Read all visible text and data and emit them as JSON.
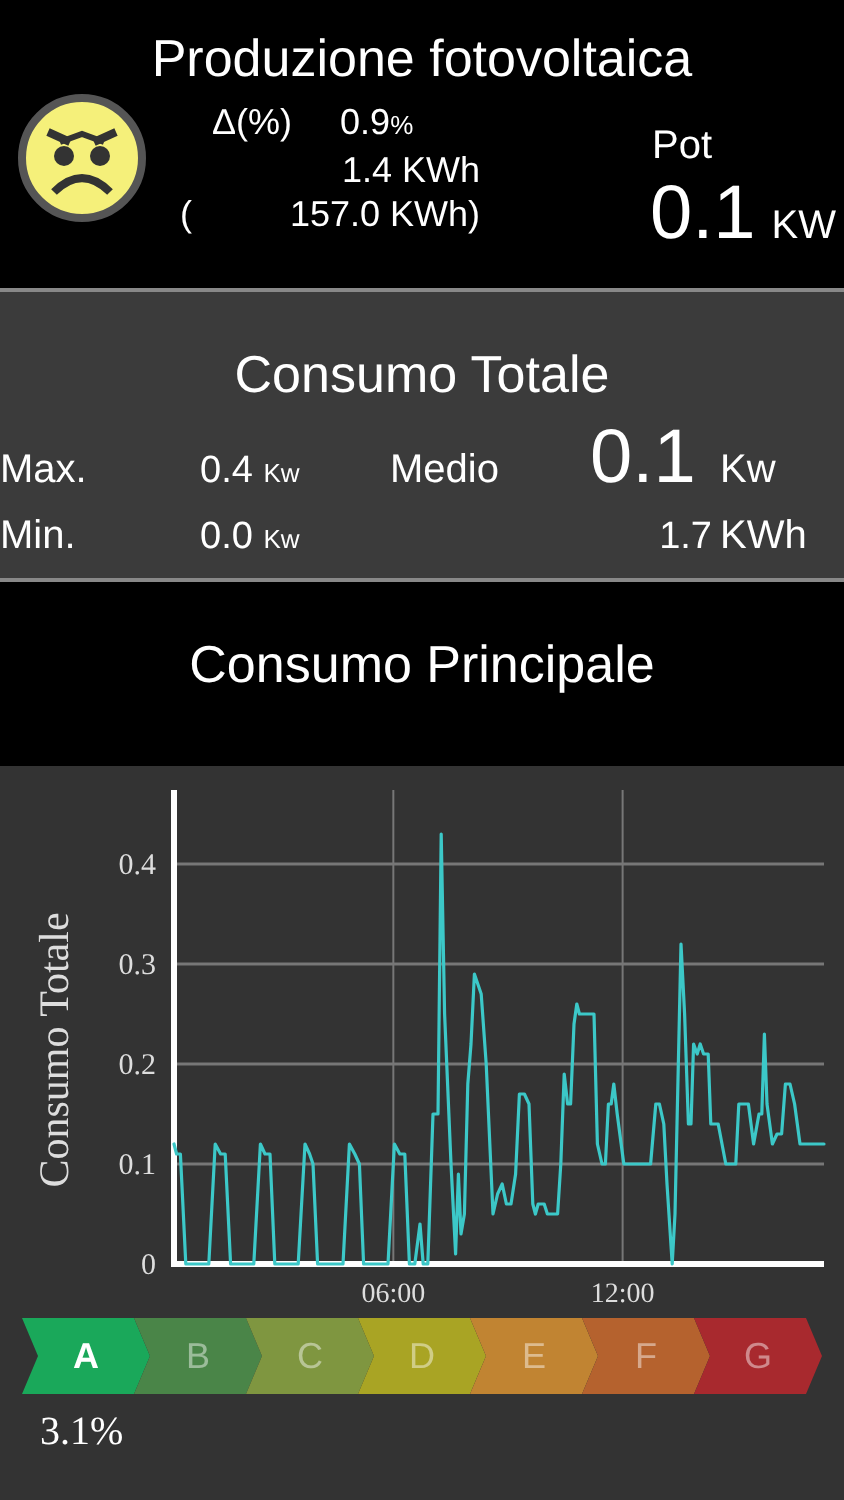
{
  "production": {
    "title": "Produzione fotovoltaica",
    "delta_label": "Δ(%)",
    "delta_value": "0.9",
    "delta_unit": "%",
    "energy": "1.4 KWh",
    "total_open": "(",
    "total": "157.0 KWh)",
    "power_label": "Pot",
    "power_value": "0.1",
    "power_unit": "KW"
  },
  "sections": [
    {
      "title": "Consumo Totale",
      "max_label": "Max.",
      "max_value": "0.4",
      "max_unit": "Kw",
      "avg_label": "Medio",
      "avg_value": "0.1",
      "avg_unit": "Kw",
      "min_label": "Min.",
      "min_value": "0.0",
      "min_unit": "Kw",
      "energy_value": "1.7",
      "energy_unit": "KWh"
    },
    {
      "title": "Consumo Principale"
    }
  ],
  "chart": {
    "chart_data": {
      "type": "line",
      "grid": true,
      "ylabel": "Consumo Totale",
      "xlim": [
        0.26,
        17.27
      ],
      "ylim": [
        0,
        0.47
      ],
      "yticks": [
        0,
        0.1,
        0.2,
        0.3,
        0.4
      ],
      "xticks": [
        {
          "value": 6,
          "label": "06:00"
        },
        {
          "value": 12,
          "label": "12:00"
        }
      ],
      "x": [
        0.26,
        0.33,
        0.43,
        0.57,
        1.17,
        1.34,
        1.48,
        1.6,
        1.74,
        2.35,
        2.52,
        2.64,
        2.77,
        2.9,
        3.51,
        3.69,
        3.81,
        3.9,
        4.02,
        4.68,
        4.85,
        4.99,
        5.11,
        5.22,
        5.86,
        6.03,
        6.17,
        6.3,
        6.42,
        6.56,
        6.7,
        6.78,
        6.9,
        7.04,
        7.17,
        7.25,
        7.34,
        7.51,
        7.63,
        7.7,
        7.77,
        7.86,
        7.95,
        8.03,
        8.12,
        8.21,
        8.3,
        8.43,
        8.61,
        8.73,
        8.85,
        8.96,
        9.08,
        9.2,
        9.3,
        9.43,
        9.55,
        9.65,
        9.72,
        9.79,
        9.95,
        10.03,
        10.3,
        10.38,
        10.47,
        10.56,
        10.64,
        10.73,
        10.8,
        10.87,
        11.25,
        11.34,
        11.46,
        11.55,
        11.63,
        11.7,
        11.77,
        11.86,
        12.03,
        12.73,
        12.87,
        12.96,
        13.08,
        13.16,
        13.3,
        13.37,
        13.53,
        13.62,
        13.72,
        13.79,
        13.86,
        13.95,
        14.03,
        14.12,
        14.24,
        14.31,
        14.5,
        14.7,
        14.96,
        15.04,
        15.29,
        15.43,
        15.57,
        15.64,
        15.71,
        15.78,
        15.92,
        16.04,
        16.16,
        16.26,
        16.38,
        16.5,
        16.64,
        17.27
      ],
      "series": [
        {
          "color": "#3cc8c8",
          "values": [
            0.12,
            0.11,
            0.11,
            0,
            0,
            0.12,
            0.11,
            0.11,
            0,
            0,
            0.12,
            0.11,
            0.11,
            0,
            0,
            0.12,
            0.11,
            0.1,
            0,
            0,
            0.12,
            0.11,
            0.1,
            0,
            0,
            0.12,
            0.11,
            0.11,
            0,
            0,
            0.04,
            0,
            0,
            0.15,
            0.15,
            0.43,
            0.25,
            0.1,
            0.01,
            0.09,
            0.03,
            0.05,
            0.18,
            0.22,
            0.29,
            0.28,
            0.27,
            0.2,
            0.05,
            0.07,
            0.08,
            0.06,
            0.06,
            0.09,
            0.17,
            0.17,
            0.16,
            0.06,
            0.05,
            0.06,
            0.06,
            0.05,
            0.05,
            0.1,
            0.19,
            0.16,
            0.16,
            0.24,
            0.26,
            0.25,
            0.25,
            0.12,
            0.1,
            0.1,
            0.16,
            0.16,
            0.18,
            0.15,
            0.1,
            0.1,
            0.16,
            0.16,
            0.14,
            0.08,
            0,
            0.05,
            0.32,
            0.25,
            0.14,
            0.14,
            0.22,
            0.21,
            0.22,
            0.21,
            0.21,
            0.14,
            0.14,
            0.1,
            0.1,
            0.16,
            0.16,
            0.12,
            0.15,
            0.15,
            0.23,
            0.16,
            0.12,
            0.13,
            0.13,
            0.18,
            0.18,
            0.16,
            0.12,
            0.12
          ]
        }
      ]
    }
  },
  "rating": {
    "classes": [
      {
        "label": "A",
        "color": "#1aa85a",
        "selected": true
      },
      {
        "label": "B",
        "color": "#4a8548",
        "selected": false
      },
      {
        "label": "C",
        "color": "#7f9640",
        "selected": false
      },
      {
        "label": "D",
        "color": "#a9a424",
        "selected": false
      },
      {
        "label": "E",
        "color": "#c18432",
        "selected": false
      },
      {
        "label": "F",
        "color": "#b5622e",
        "selected": false
      },
      {
        "label": "G",
        "color": "#a8292e",
        "selected": false
      }
    ],
    "percentage": "3.1%"
  }
}
